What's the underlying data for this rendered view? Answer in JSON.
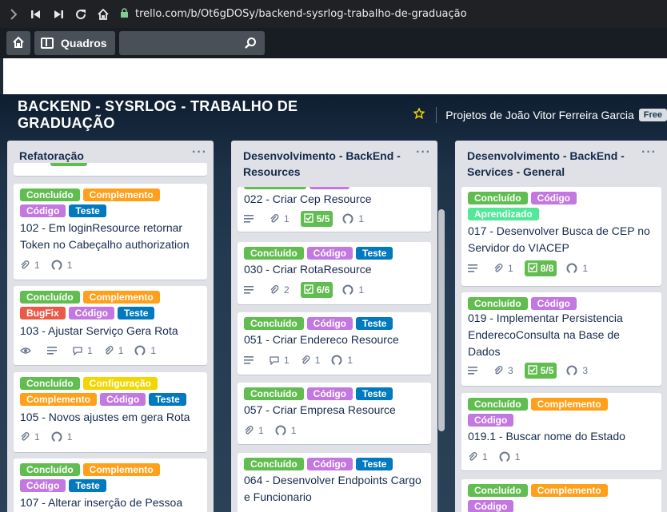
{
  "browser": {
    "url": "trello.com/b/Ot6gDOSy/backend-sysrlog-trabalho-de-graduação"
  },
  "header": {
    "boards_label": "Quadros",
    "search_placeholder": ""
  },
  "board": {
    "title": "BACKEND - SYSRLOG - TRABALHO DE GRADUAÇÃO",
    "team": "Projetos de João Vitor Ferreira Garcia",
    "plan": "Free"
  },
  "colors": {
    "green": "#61bd4f",
    "orange": "#ff9f1a",
    "purple": "#c377e0",
    "blue": "#0079bf",
    "red": "#eb5a46",
    "yellow": "#f2d600",
    "lime": "#51e898"
  },
  "lists": [
    {
      "title": "Refatoração",
      "cards": [
        {
          "labels": [],
          "title": "",
          "badges": []
        },
        {
          "labels": [
            {
              "text": "Concluído",
              "color": "green"
            },
            {
              "text": "Complemento",
              "color": "orange"
            },
            {
              "text": "Código",
              "color": "purple"
            },
            {
              "text": "Teste",
              "color": "blue"
            }
          ],
          "title": "102 - Em loginResource retornar Token no Cabeçalho authorization",
          "badges": [
            {
              "type": "attachment",
              "count": "1"
            },
            {
              "type": "github",
              "count": "1"
            }
          ]
        },
        {
          "labels": [
            {
              "text": "Concluído",
              "color": "green"
            },
            {
              "text": "Complemento",
              "color": "orange"
            },
            {
              "text": "BugFix",
              "color": "red"
            },
            {
              "text": "Código",
              "color": "purple"
            },
            {
              "text": "Teste",
              "color": "blue"
            }
          ],
          "title": "103 - Ajustar Serviço Gera Rota",
          "badges": [
            {
              "type": "watch"
            },
            {
              "type": "description"
            },
            {
              "type": "comment",
              "count": "1"
            },
            {
              "type": "attachment",
              "count": "1"
            },
            {
              "type": "github",
              "count": "1"
            }
          ]
        },
        {
          "labels": [
            {
              "text": "Concluído",
              "color": "green"
            },
            {
              "text": "Configuração",
              "color": "yellow"
            },
            {
              "text": "Complemento",
              "color": "orange"
            },
            {
              "text": "Código",
              "color": "purple"
            },
            {
              "text": "Teste",
              "color": "blue"
            }
          ],
          "title": "105 - Novos ajustes em gera Rota",
          "badges": [
            {
              "type": "attachment",
              "count": "1"
            },
            {
              "type": "github",
              "count": "1"
            }
          ]
        },
        {
          "labels": [
            {
              "text": "Concluído",
              "color": "green"
            },
            {
              "text": "Complemento",
              "color": "orange"
            },
            {
              "text": "Código",
              "color": "purple"
            },
            {
              "text": "Teste",
              "color": "blue"
            }
          ],
          "title": "107 - Alterar inserção de Pessoa",
          "badges": []
        }
      ]
    },
    {
      "title": "Desenvolvimento - BackEnd - Resources",
      "cards": [
        {
          "labels": [],
          "title": "022 - Criar Cep Resource",
          "badges": [
            {
              "type": "description"
            },
            {
              "type": "attachment",
              "count": "1"
            },
            {
              "type": "checklist",
              "count": "5/5"
            },
            {
              "type": "github",
              "count": "1"
            }
          ]
        },
        {
          "labels": [
            {
              "text": "Concluído",
              "color": "green"
            },
            {
              "text": "Código",
              "color": "purple"
            },
            {
              "text": "Teste",
              "color": "blue"
            }
          ],
          "title": "030 - Criar RotaResource",
          "badges": [
            {
              "type": "description"
            },
            {
              "type": "attachment",
              "count": "2"
            },
            {
              "type": "checklist",
              "count": "6/6"
            },
            {
              "type": "github",
              "count": "1"
            }
          ]
        },
        {
          "labels": [
            {
              "text": "Concluído",
              "color": "green"
            },
            {
              "text": "Código",
              "color": "purple"
            },
            {
              "text": "Teste",
              "color": "blue"
            }
          ],
          "title": "051 - Criar Endereco Resource",
          "badges": [
            {
              "type": "description"
            },
            {
              "type": "comment",
              "count": "1"
            },
            {
              "type": "attachment",
              "count": "1"
            },
            {
              "type": "github",
              "count": "1"
            }
          ]
        },
        {
          "labels": [
            {
              "text": "Concluído",
              "color": "green"
            },
            {
              "text": "Código",
              "color": "purple"
            },
            {
              "text": "Teste",
              "color": "blue"
            }
          ],
          "title": "057 - Criar Empresa Resource",
          "badges": [
            {
              "type": "attachment",
              "count": "1"
            },
            {
              "type": "github",
              "count": "1"
            }
          ]
        },
        {
          "labels": [
            {
              "text": "Concluído",
              "color": "green"
            },
            {
              "text": "Código",
              "color": "purple"
            },
            {
              "text": "Teste",
              "color": "blue"
            }
          ],
          "title": "064 - Desenvolver Endpoints Cargo e Funcionario",
          "badges": []
        }
      ]
    },
    {
      "title": "Desenvolvimento - BackEnd - Services - General",
      "cards": [
        {
          "labels": [
            {
              "text": "Concluído",
              "color": "green"
            },
            {
              "text": "Código",
              "color": "purple"
            },
            {
              "text": "Aprendizado",
              "color": "lime"
            }
          ],
          "title": "017 - Desenvolver Busca de CEP no Servidor do VIACEP",
          "badges": [
            {
              "type": "description"
            },
            {
              "type": "attachment",
              "count": "1"
            },
            {
              "type": "checklist",
              "count": "8/8"
            },
            {
              "type": "github",
              "count": "1"
            }
          ]
        },
        {
          "labels": [
            {
              "text": "Concluído",
              "color": "green"
            },
            {
              "text": "Código",
              "color": "purple"
            }
          ],
          "title": "019 - Implementar Persistencia EnderecoConsulta na Base de Dados",
          "badges": [
            {
              "type": "description"
            },
            {
              "type": "attachment",
              "count": "3"
            },
            {
              "type": "checklist",
              "count": "5/5"
            },
            {
              "type": "github",
              "count": "3"
            }
          ]
        },
        {
          "labels": [
            {
              "text": "Concluído",
              "color": "green"
            },
            {
              "text": "Complemento",
              "color": "orange"
            },
            {
              "text": "Código",
              "color": "purple"
            }
          ],
          "title": "019.1 - Buscar nome do Estado",
          "badges": [
            {
              "type": "attachment",
              "count": "1"
            },
            {
              "type": "github",
              "count": "1"
            }
          ]
        },
        {
          "labels": [
            {
              "text": "Concluído",
              "color": "green"
            },
            {
              "text": "Complemento",
              "color": "orange"
            },
            {
              "text": "Código",
              "color": "purple"
            }
          ],
          "title": "",
          "badges": []
        }
      ]
    }
  ]
}
